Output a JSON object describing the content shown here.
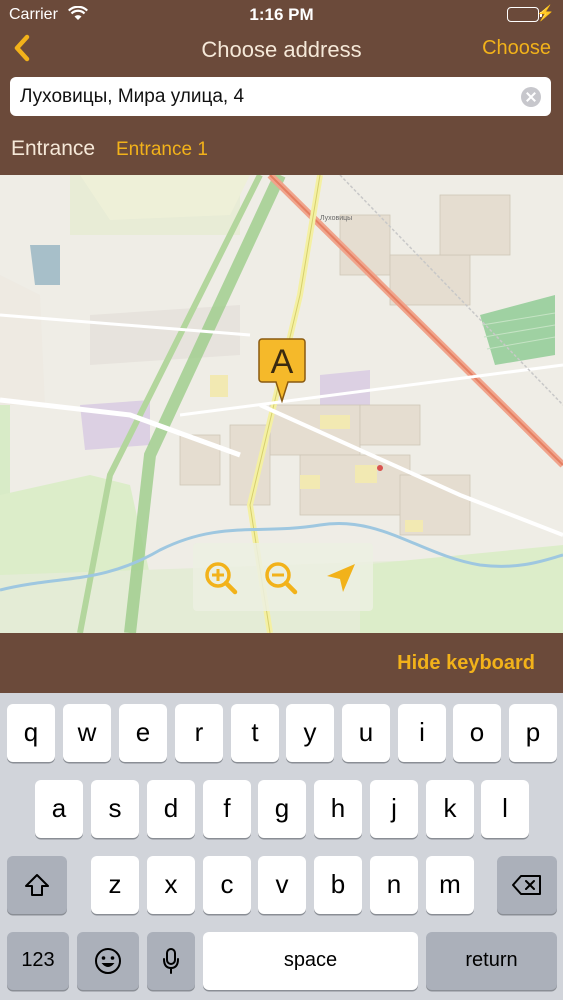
{
  "status_bar": {
    "carrier": "Carrier",
    "time": "1:16 PM"
  },
  "nav": {
    "title": "Choose address",
    "choose_label": "Choose"
  },
  "search": {
    "value": "Луховицы, Мира улица, 4"
  },
  "entrance": {
    "label": "Entrance",
    "value": "Entrance 1"
  },
  "map": {
    "marker_letter": "A",
    "labels": {
      "town": "Луховицы"
    }
  },
  "keyboard_bar": {
    "hide_label": "Hide keyboard"
  },
  "keyboard": {
    "row1": [
      "q",
      "w",
      "e",
      "r",
      "t",
      "y",
      "u",
      "i",
      "o",
      "p"
    ],
    "row2": [
      "a",
      "s",
      "d",
      "f",
      "g",
      "h",
      "j",
      "k",
      "l"
    ],
    "row3": [
      "z",
      "x",
      "c",
      "v",
      "b",
      "n",
      "m"
    ],
    "numbers_label": "123",
    "space_label": "space",
    "return_label": "return"
  },
  "colors": {
    "header_brown": "#6b4a3a",
    "accent_orange": "#f2b21a",
    "keyboard_bg": "#d1d4da"
  }
}
